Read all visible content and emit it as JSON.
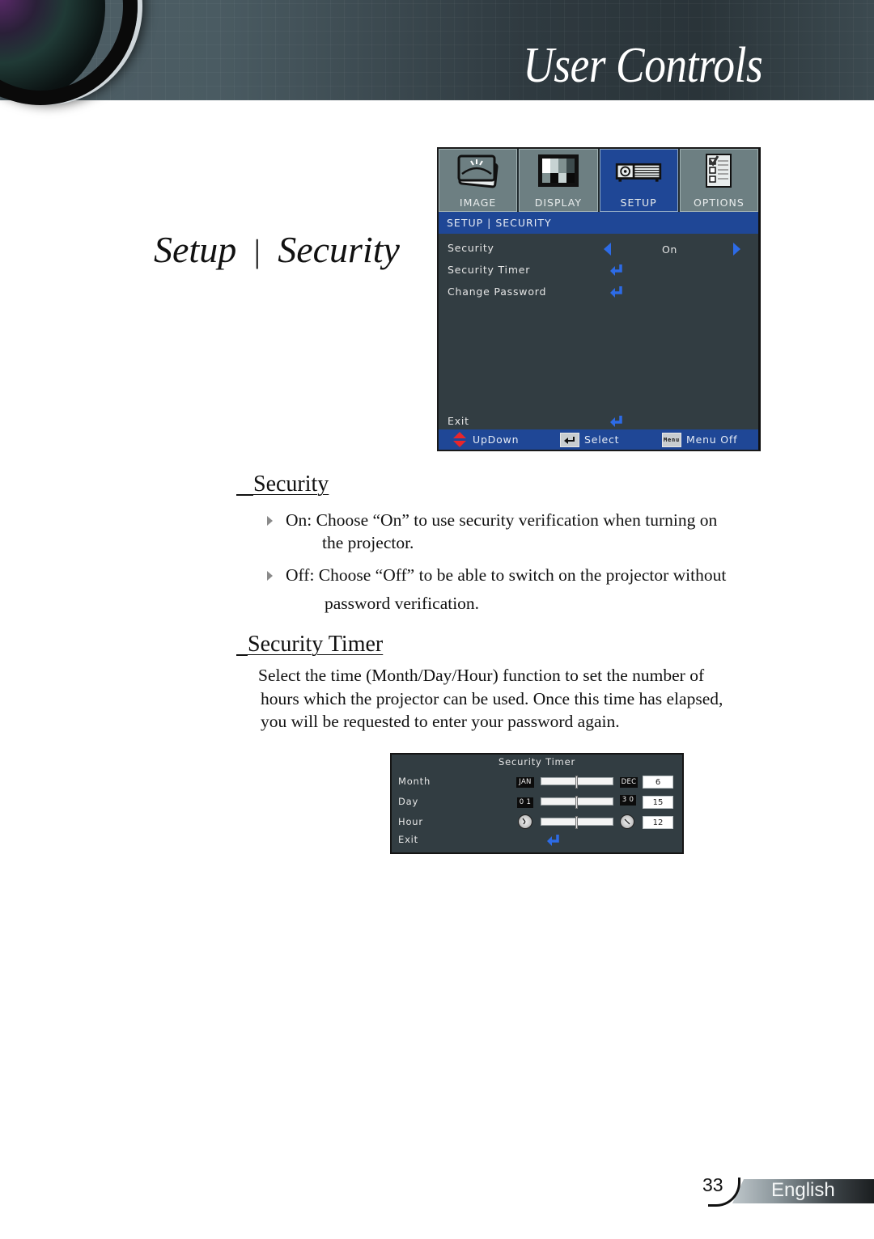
{
  "header": {
    "title": "User Controls"
  },
  "page_heading": {
    "part1": "Setup",
    "separator": "|",
    "part2": "Security"
  },
  "osd_menu": {
    "tabs": [
      {
        "label": "IMAGE",
        "icon": "image-icon",
        "active": false
      },
      {
        "label": "DISPLAY",
        "icon": "display-icon",
        "active": false
      },
      {
        "label": "SETUP",
        "icon": "projector-icon",
        "active": true
      },
      {
        "label": "OPTIONS",
        "icon": "checklist-icon",
        "active": false
      }
    ],
    "breadcrumb": "SETUP | SECURITY",
    "items": [
      {
        "label": "Security",
        "control": "selector",
        "value": "On"
      },
      {
        "label": "Security Timer",
        "control": "enter"
      },
      {
        "label": "Change Password",
        "control": "enter"
      }
    ],
    "exit_label": "Exit",
    "footer": {
      "updown_label": "UpDown",
      "select_label": "Select",
      "menu_key_label": "Menu",
      "menu_off_label": "Menu Off"
    },
    "colors": {
      "accent": "#1f4796",
      "arrow": "#2d6be6",
      "body": "#323d42"
    }
  },
  "sections": {
    "security": {
      "title": "Security",
      "bullets": [
        {
          "line1": "On: Choose “On” to use security verification when turning on",
          "line2": "the projector."
        },
        {
          "line1": "Off: Choose “Off” to be able to switch on the projector without",
          "line2": "password verification."
        }
      ]
    },
    "security_timer": {
      "title": "Security Timer",
      "lines": [
        "Select the time (Month/Day/Hour) function to set the number of",
        "hours which the projector can be used. Once this time has elapsed,",
        "you will be requested to enter your password again."
      ]
    }
  },
  "timer_dialog": {
    "title": "Security Timer",
    "rows": [
      {
        "label": "Month",
        "min_label": "JAN",
        "max_label": "DEC",
        "value": "6",
        "fraction": 0.5
      },
      {
        "label": "Day",
        "min_label": "0 1",
        "max_label": "3 0",
        "value": "15",
        "fraction": 0.5
      },
      {
        "label": "Hour",
        "min_label": "clock-min",
        "max_label": "clock-max",
        "value": "12",
        "fraction": 0.5
      }
    ],
    "exit_label": "Exit"
  },
  "footer": {
    "page_number": "33",
    "language": "English"
  }
}
